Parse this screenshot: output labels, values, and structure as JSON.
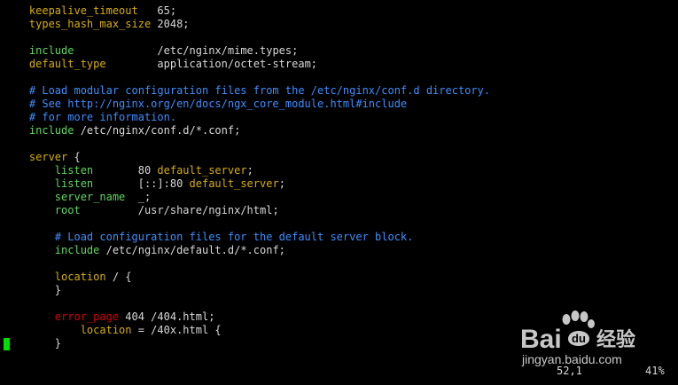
{
  "colors": {
    "background": "#000000",
    "text": "#d8d8d8",
    "directive": "#5fd75f",
    "keyword": "#d7af00",
    "comment": "#3a8fff",
    "error": "#d70000",
    "cursor": "#00e000"
  },
  "lines": [
    [
      {
        "t": "    ",
        "c": "text"
      },
      {
        "t": "keepalive_timeout",
        "c": "keyword"
      },
      {
        "t": "   65;",
        "c": "text"
      }
    ],
    [
      {
        "t": "    ",
        "c": "text"
      },
      {
        "t": "types_hash_max_size",
        "c": "keyword"
      },
      {
        "t": " 2048;",
        "c": "text"
      }
    ],
    [],
    [
      {
        "t": "    ",
        "c": "text"
      },
      {
        "t": "include",
        "c": "directive"
      },
      {
        "t": "             /etc/nginx/mime.types;",
        "c": "text"
      }
    ],
    [
      {
        "t": "    ",
        "c": "text"
      },
      {
        "t": "default_type",
        "c": "keyword"
      },
      {
        "t": "        application/octet-stream;",
        "c": "text"
      }
    ],
    [],
    [
      {
        "t": "    # Load modular configuration files from the /etc/nginx/conf.d directory.",
        "c": "comment"
      }
    ],
    [
      {
        "t": "    # See http://nginx.org/en/docs/ngx_core_module.html#include",
        "c": "comment"
      }
    ],
    [
      {
        "t": "    # for more information.",
        "c": "comment"
      }
    ],
    [
      {
        "t": "    ",
        "c": "text"
      },
      {
        "t": "include",
        "c": "directive"
      },
      {
        "t": " /etc/nginx/conf.d/*.conf;",
        "c": "text"
      }
    ],
    [],
    [
      {
        "t": "    ",
        "c": "text"
      },
      {
        "t": "server",
        "c": "keyword"
      },
      {
        "t": " {",
        "c": "text"
      }
    ],
    [
      {
        "t": "        ",
        "c": "text"
      },
      {
        "t": "listen",
        "c": "directive"
      },
      {
        "t": "       80 ",
        "c": "text"
      },
      {
        "t": "default_server",
        "c": "keyword"
      },
      {
        "t": ";",
        "c": "text"
      }
    ],
    [
      {
        "t": "        ",
        "c": "text"
      },
      {
        "t": "listen",
        "c": "directive"
      },
      {
        "t": "       [::]:80 ",
        "c": "text"
      },
      {
        "t": "default_server",
        "c": "keyword"
      },
      {
        "t": ";",
        "c": "text"
      }
    ],
    [
      {
        "t": "        ",
        "c": "text"
      },
      {
        "t": "server_name",
        "c": "directive"
      },
      {
        "t": "  _;",
        "c": "text"
      }
    ],
    [
      {
        "t": "        ",
        "c": "text"
      },
      {
        "t": "root",
        "c": "directive"
      },
      {
        "t": "         /usr/share/nginx/html;",
        "c": "text"
      }
    ],
    [],
    [
      {
        "t": "        # Load configuration files for the default server block.",
        "c": "comment"
      }
    ],
    [
      {
        "t": "        ",
        "c": "text"
      },
      {
        "t": "include",
        "c": "directive"
      },
      {
        "t": " /etc/nginx/default.d/*.conf;",
        "c": "text"
      }
    ],
    [],
    [
      {
        "t": "        ",
        "c": "text"
      },
      {
        "t": "location",
        "c": "keyword"
      },
      {
        "t": " / {",
        "c": "text"
      }
    ],
    [
      {
        "t": "        }",
        "c": "text"
      }
    ],
    [],
    [
      {
        "t": "        ",
        "c": "text"
      },
      {
        "t": "error_page",
        "c": "error"
      },
      {
        "t": " 404 /404.html;",
        "c": "text"
      }
    ],
    [
      {
        "t": "            ",
        "c": "text"
      },
      {
        "t": "location",
        "c": "keyword"
      },
      {
        "t": " = /40x.html {",
        "c": "text"
      }
    ],
    [
      {
        "t": "        }",
        "c": "text"
      }
    ]
  ],
  "status": {
    "position": "52,1",
    "percent": "41%"
  },
  "watermark": {
    "brand": "Bai",
    "brand_cn": "经验",
    "url": "jingyan.baidu.com"
  }
}
